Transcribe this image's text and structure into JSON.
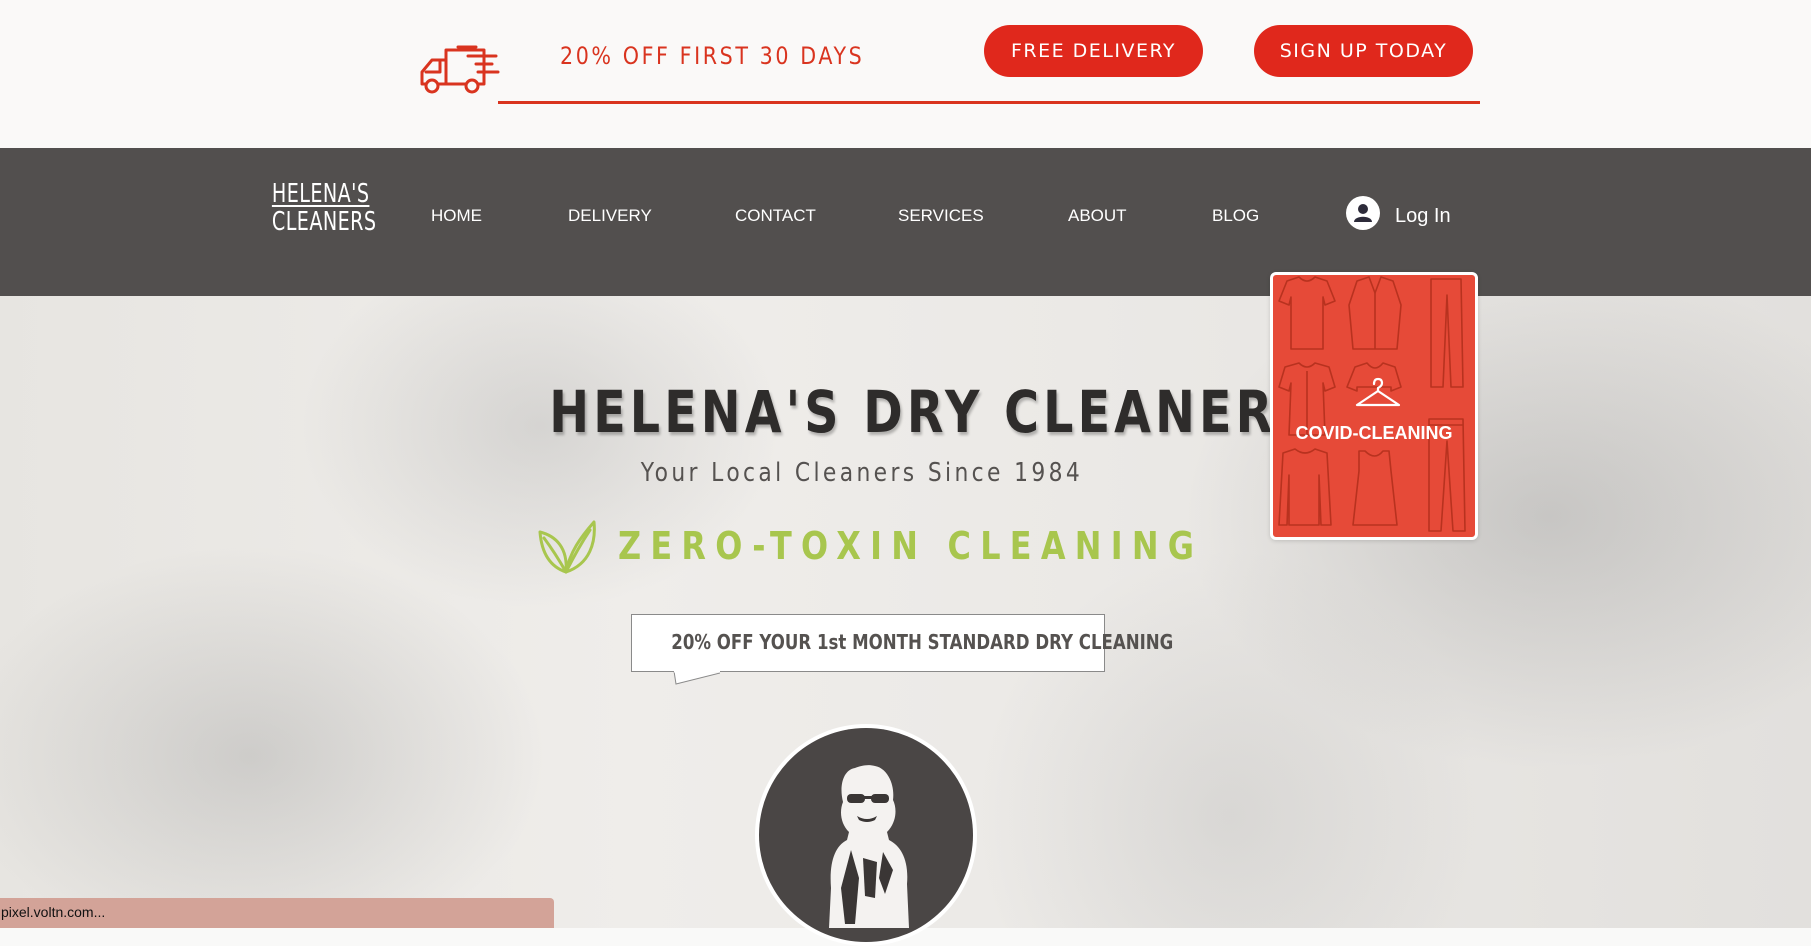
{
  "promo": {
    "text": "20% OFF FIRST 30 DAYS",
    "free_delivery": "FREE DELIVERY",
    "sign_up": "SIGN UP TODAY",
    "truck_icon": "delivery-truck-icon"
  },
  "nav": {
    "logo_line1": "HELENA'S",
    "logo_line2": "CLEANERS",
    "items": [
      {
        "label": "HOME"
      },
      {
        "label": "DELIVERY"
      },
      {
        "label": "CONTACT"
      },
      {
        "label": "SERVICES"
      },
      {
        "label": "ABOUT"
      },
      {
        "label": "BLOG"
      }
    ],
    "login_label": "Log In",
    "login_icon": "user-avatar-icon"
  },
  "hero": {
    "title": "HELENA'S DRY CLEANERS",
    "subtitle": "Your Local Cleaners Since 1984",
    "zero_toxin": "ZERO-TOXIN CLEANING",
    "leaf_icon": "leaf-icon",
    "offer": "20% OFF YOUR 1st MONTH STANDARD DRY CLEANING",
    "portrait_icon": "helena-portrait"
  },
  "covid_card": {
    "label": "COVID-CLEANING",
    "icon": "hanger-icon"
  },
  "status_bar": {
    "text": "pixel.voltn.com..."
  },
  "colors": {
    "accent_red": "#e0281c",
    "nav_bg": "#524f4e",
    "leaf_green": "#a8c64e",
    "card_red": "#e64a38"
  }
}
